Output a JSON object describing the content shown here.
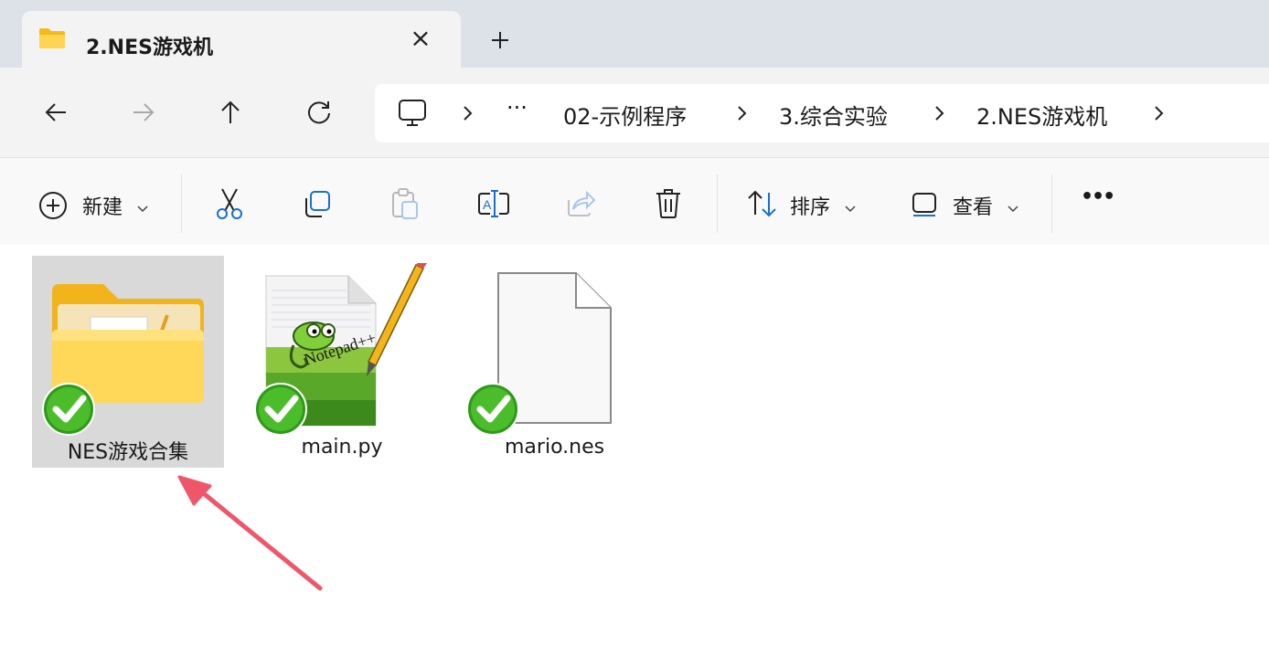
{
  "window": {
    "tab_title": "2.NES游戏机",
    "close_symbol": "×",
    "new_tab_symbol": "+"
  },
  "nav": {
    "buttons": [
      {
        "name": "back-icon",
        "enabled": true
      },
      {
        "name": "forward-icon",
        "enabled": false
      },
      {
        "name": "up-icon",
        "enabled": true
      },
      {
        "name": "refresh-icon",
        "enabled": true
      }
    ],
    "breadcrumb": {
      "root_icon": "monitor-icon",
      "overflow": "···",
      "segments": [
        "02-示例程序",
        "3.综合实验",
        "2.NES游戏机"
      ]
    }
  },
  "toolbar": {
    "new_label": "新建",
    "sort_label": "排序",
    "view_label": "查看",
    "more_symbol": "•••",
    "icons": [
      "plus-circle-icon",
      "cut-icon",
      "copy-icon",
      "paste-icon",
      "rename-icon",
      "share-icon",
      "delete-icon",
      "sort-icon",
      "view-icon",
      "more-icon"
    ]
  },
  "files": [
    {
      "name": "NES游戏合集",
      "kind": "folder",
      "selected": true,
      "sync_status": "synced"
    },
    {
      "name": "main.py",
      "kind": "notepad-plus-plus-file",
      "selected": false,
      "sync_status": "synced"
    },
    {
      "name": "mario.nes",
      "kind": "generic-file",
      "selected": false,
      "sync_status": "synced"
    }
  ],
  "annotation": {
    "type": "arrow",
    "color": "#f0566a",
    "points_to": "NES游戏合集"
  }
}
